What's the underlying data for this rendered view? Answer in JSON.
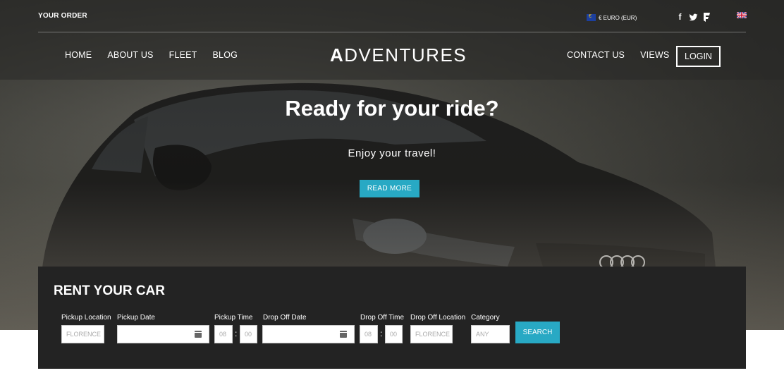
{
  "topbar": {
    "your_order": "YOUR ORDER",
    "currency": "€ EURO (EUR)",
    "social_icons": [
      "facebook-icon",
      "twitter-icon",
      "foursquare-icon"
    ],
    "language_flag": "uk-flag-icon"
  },
  "nav": {
    "left": [
      "HOME",
      "ABOUT US",
      "FLEET",
      "BLOG"
    ],
    "logo_initial": "A",
    "logo_rest": "DVENTURES",
    "right": [
      "CONTACT US",
      "VIEWS"
    ],
    "login": "LOGIN"
  },
  "hero": {
    "headline": "Ready for your ride?",
    "subline": "Enjoy your travel!",
    "cta": "READ MORE"
  },
  "rent": {
    "title": "RENT YOUR CAR",
    "pickup_location_label": "Pickup Location",
    "pickup_location_placeholder": "FLORENCE",
    "pickup_date_label": "Pickup Date",
    "pickup_time_label": "Pickup Time",
    "pickup_hour": "08",
    "pickup_minute": "00",
    "dropoff_date_label": "Drop Off Date",
    "dropoff_time_label": "Drop Off Time",
    "dropoff_hour": "08",
    "dropoff_minute": "00",
    "dropoff_location_label": "Drop Off Location",
    "dropoff_location_placeholder": "FLORENCE",
    "category_label": "Category",
    "category_placeholder": "ANY",
    "search": "SEARCH"
  },
  "colors": {
    "accent": "#28a9c4",
    "panel": "#232323"
  }
}
